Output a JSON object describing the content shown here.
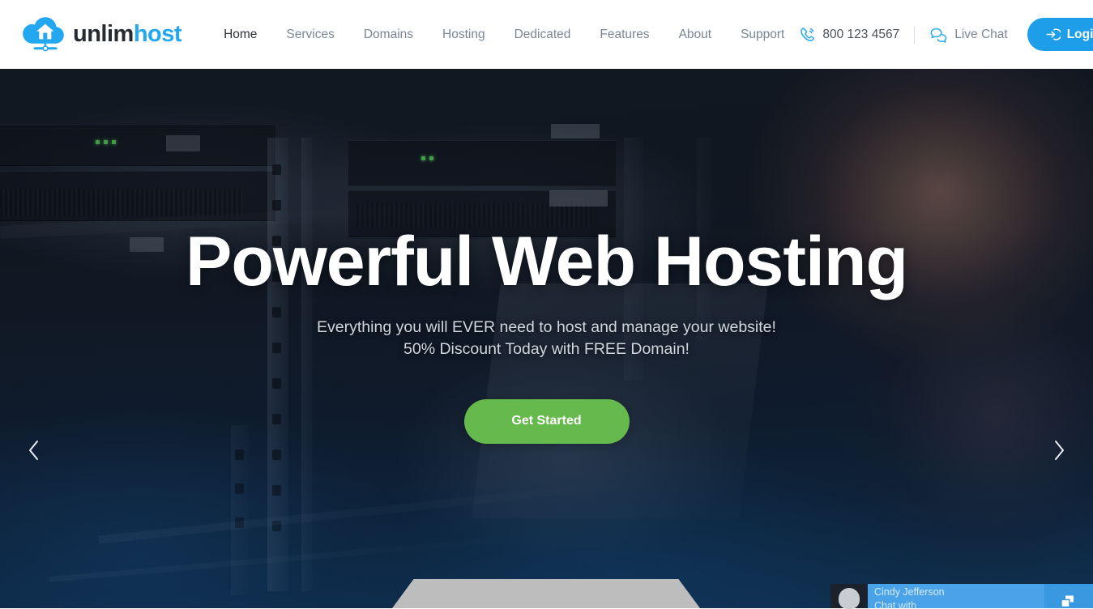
{
  "header": {
    "logo": {
      "icon": "cloud-house-icon",
      "text_dark": "unlim",
      "text_blue": "host"
    },
    "nav": [
      {
        "label": "Home",
        "active": true
      },
      {
        "label": "Services",
        "active": false
      },
      {
        "label": "Domains",
        "active": false
      },
      {
        "label": "Hosting",
        "active": false
      },
      {
        "label": "Dedicated",
        "active": false
      },
      {
        "label": "Features",
        "active": false
      },
      {
        "label": "About",
        "active": false
      },
      {
        "label": "Support",
        "active": false
      }
    ],
    "phone": {
      "icon": "phone-icon",
      "number": "800 123 4567"
    },
    "live_chat": {
      "icon": "chat-bubbles-icon",
      "label": "Live Chat"
    },
    "login": {
      "icon": "sign-in-icon",
      "label": "Login"
    }
  },
  "hero": {
    "title": "Powerful Web Hosting",
    "subtitle_line1": "Everything you will EVER need to host and manage your website!",
    "subtitle_line2": "50% Discount Today with FREE Domain!",
    "cta_label": "Get Started",
    "prev_icon": "chevron-left-icon",
    "next_icon": "chevron-right-icon"
  },
  "chat_widget": {
    "avatar": "user-avatar",
    "name": "Cindy Jefferson",
    "subtitle": "Chat with",
    "action_icon": "restore-window-icon"
  },
  "colors": {
    "brand_blue": "#22a7f0",
    "login_blue": "#1e9ee8",
    "cta_green": "#66b94c",
    "chat_blue": "#4aa3e8",
    "nav_gray": "#7b8694",
    "nav_active": "#2c3138"
  }
}
